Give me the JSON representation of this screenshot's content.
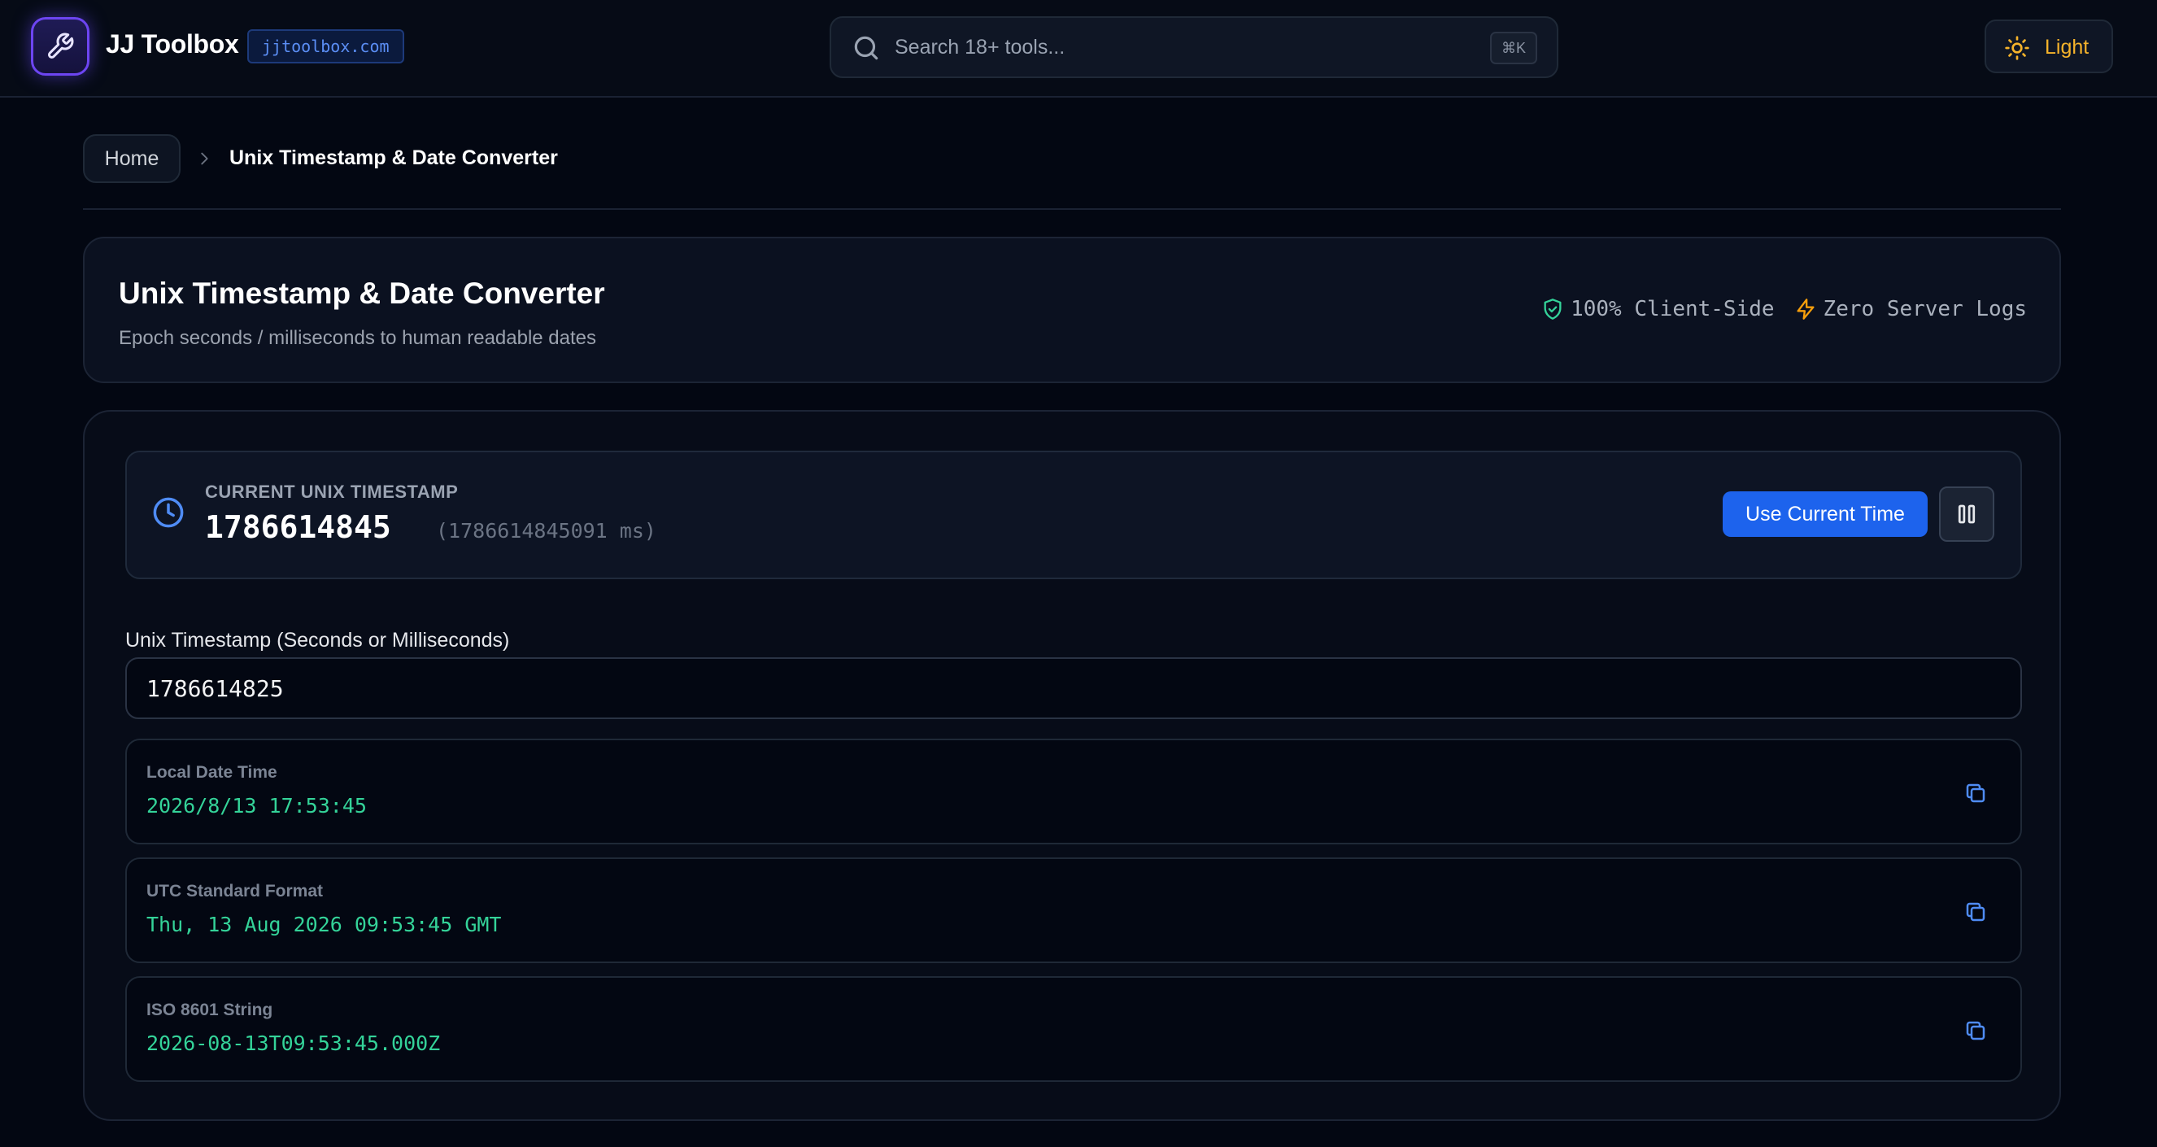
{
  "header": {
    "brand_name": "JJ Toolbox",
    "domain": "jjtoolbox.com",
    "search_placeholder": "Search 18+ tools...",
    "search_shortcut": "⌘K",
    "theme_toggle_label": "Light"
  },
  "breadcrumb": {
    "home": "Home",
    "current": "Unix Timestamp & Date Converter"
  },
  "tool": {
    "title": "Unix Timestamp & Date Converter",
    "subtitle": "Epoch seconds / milliseconds to human readable dates",
    "badge_client_side": "100% Client-Side",
    "badge_no_logs": "Zero Server Logs"
  },
  "current_time": {
    "label": "CURRENT UNIX TIMESTAMP",
    "seconds": "1786614845",
    "milliseconds": "(1786614845091 ms)",
    "use_current_button": "Use Current Time"
  },
  "input": {
    "label": "Unix Timestamp (Seconds or Milliseconds)",
    "value": "1786614825"
  },
  "results": [
    {
      "label": "Local Date Time",
      "value": "2026/8/13 17:53:45"
    },
    {
      "label": "UTC Standard Format",
      "value": "Thu, 13 Aug 2026 09:53:45 GMT"
    },
    {
      "label": "ISO 8601 String",
      "value": "2026-08-13T09:53:45.000Z"
    }
  ],
  "colors": {
    "background": "#030712",
    "accent_blue": "#1d63ed",
    "result_green": "#34d399",
    "theme_yellow": "#f5b32b",
    "logo_purple": "#6d45f2"
  },
  "icons": {
    "logo": "wrench-icon",
    "search": "search-icon",
    "theme": "sun-icon",
    "breadcrumb_separator": "chevron-right-icon",
    "client_side": "shield-check-icon",
    "no_logs": "lightning-icon",
    "current_time": "clock-icon",
    "pause": "pause-icon",
    "copy": "copy-icon"
  }
}
